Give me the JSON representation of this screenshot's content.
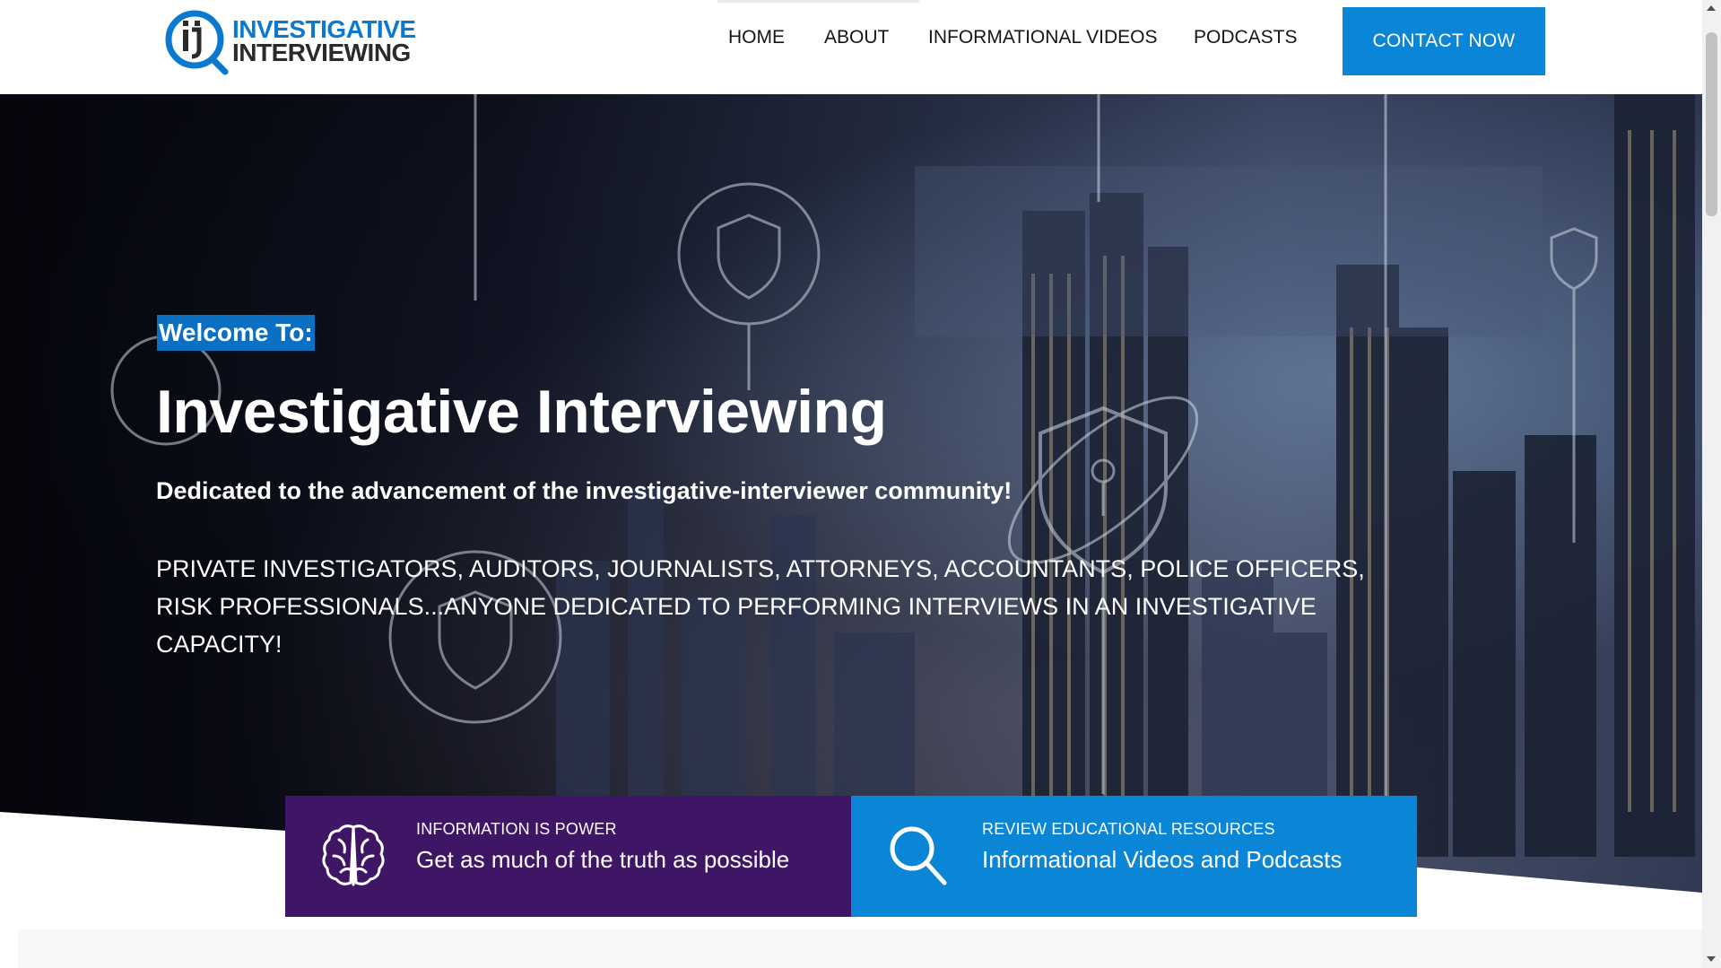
{
  "header": {
    "logo": {
      "line1": "INVESTIGATIVE",
      "line2": "INTERVIEWING",
      "icon": "magnifier-ii-logo-icon"
    },
    "nav": [
      {
        "label": "HOME"
      },
      {
        "label": "ABOUT"
      },
      {
        "label": "INFORMATIONAL VIDEOS"
      },
      {
        "label": "PODCASTS"
      }
    ],
    "cta_label": "CONTACT NOW"
  },
  "hero": {
    "welcome": "Welcome To:",
    "title": "Investigative Interviewing",
    "subtitle": "Dedicated to the advancement of the investigative-interviewer community!",
    "body": "PRIVATE INVESTIGATORS, AUDITORS, JOURNALISTS, ATTORNEYS, ACCOUNTANTS, POLICE OFFICERS, RISK PROFESSIONALS...ANYONE DEDICATED TO PERFORMING INTERVIEWS IN AN INVESTIGATIVE CAPACITY!"
  },
  "features": [
    {
      "kicker": "INFORMATION IS POWER",
      "headline": "Get as much of the truth as possible",
      "icon": "brain-icon"
    },
    {
      "kicker": "REVIEW EDUCATIONAL RESOURCES",
      "headline": "Informational Videos and Podcasts",
      "icon": "magnifier-icon"
    }
  ],
  "colors": {
    "brand_blue": "#0b86d6",
    "purple": "#3f1566",
    "welcome_bg": "#0b6fc2"
  }
}
